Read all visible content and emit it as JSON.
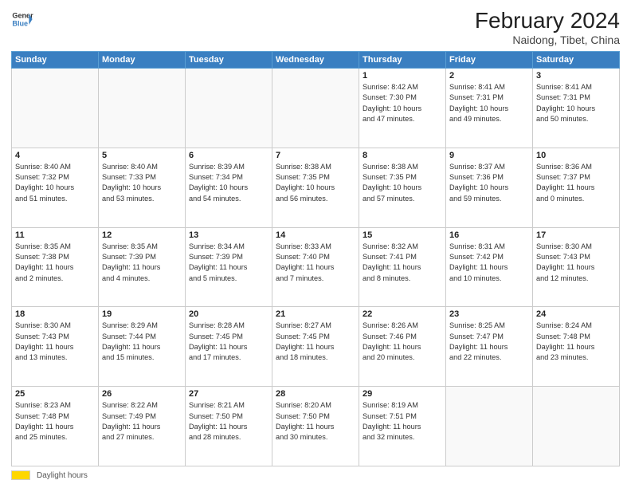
{
  "header": {
    "logo_line1": "General",
    "logo_line2": "Blue",
    "title": "February 2024",
    "subtitle": "Naidong, Tibet, China"
  },
  "days_of_week": [
    "Sunday",
    "Monday",
    "Tuesday",
    "Wednesday",
    "Thursday",
    "Friday",
    "Saturday"
  ],
  "footer": {
    "swatch_label": "Daylight hours"
  },
  "weeks": [
    [
      {
        "day": null,
        "info": null
      },
      {
        "day": null,
        "info": null
      },
      {
        "day": null,
        "info": null
      },
      {
        "day": null,
        "info": null
      },
      {
        "day": "1",
        "info": "Sunrise: 8:42 AM\nSunset: 7:30 PM\nDaylight: 10 hours\nand 47 minutes."
      },
      {
        "day": "2",
        "info": "Sunrise: 8:41 AM\nSunset: 7:31 PM\nDaylight: 10 hours\nand 49 minutes."
      },
      {
        "day": "3",
        "info": "Sunrise: 8:41 AM\nSunset: 7:31 PM\nDaylight: 10 hours\nand 50 minutes."
      }
    ],
    [
      {
        "day": "4",
        "info": "Sunrise: 8:40 AM\nSunset: 7:32 PM\nDaylight: 10 hours\nand 51 minutes."
      },
      {
        "day": "5",
        "info": "Sunrise: 8:40 AM\nSunset: 7:33 PM\nDaylight: 10 hours\nand 53 minutes."
      },
      {
        "day": "6",
        "info": "Sunrise: 8:39 AM\nSunset: 7:34 PM\nDaylight: 10 hours\nand 54 minutes."
      },
      {
        "day": "7",
        "info": "Sunrise: 8:38 AM\nSunset: 7:35 PM\nDaylight: 10 hours\nand 56 minutes."
      },
      {
        "day": "8",
        "info": "Sunrise: 8:38 AM\nSunset: 7:35 PM\nDaylight: 10 hours\nand 57 minutes."
      },
      {
        "day": "9",
        "info": "Sunrise: 8:37 AM\nSunset: 7:36 PM\nDaylight: 10 hours\nand 59 minutes."
      },
      {
        "day": "10",
        "info": "Sunrise: 8:36 AM\nSunset: 7:37 PM\nDaylight: 11 hours\nand 0 minutes."
      }
    ],
    [
      {
        "day": "11",
        "info": "Sunrise: 8:35 AM\nSunset: 7:38 PM\nDaylight: 11 hours\nand 2 minutes."
      },
      {
        "day": "12",
        "info": "Sunrise: 8:35 AM\nSunset: 7:39 PM\nDaylight: 11 hours\nand 4 minutes."
      },
      {
        "day": "13",
        "info": "Sunrise: 8:34 AM\nSunset: 7:39 PM\nDaylight: 11 hours\nand 5 minutes."
      },
      {
        "day": "14",
        "info": "Sunrise: 8:33 AM\nSunset: 7:40 PM\nDaylight: 11 hours\nand 7 minutes."
      },
      {
        "day": "15",
        "info": "Sunrise: 8:32 AM\nSunset: 7:41 PM\nDaylight: 11 hours\nand 8 minutes."
      },
      {
        "day": "16",
        "info": "Sunrise: 8:31 AM\nSunset: 7:42 PM\nDaylight: 11 hours\nand 10 minutes."
      },
      {
        "day": "17",
        "info": "Sunrise: 8:30 AM\nSunset: 7:43 PM\nDaylight: 11 hours\nand 12 minutes."
      }
    ],
    [
      {
        "day": "18",
        "info": "Sunrise: 8:30 AM\nSunset: 7:43 PM\nDaylight: 11 hours\nand 13 minutes."
      },
      {
        "day": "19",
        "info": "Sunrise: 8:29 AM\nSunset: 7:44 PM\nDaylight: 11 hours\nand 15 minutes."
      },
      {
        "day": "20",
        "info": "Sunrise: 8:28 AM\nSunset: 7:45 PM\nDaylight: 11 hours\nand 17 minutes."
      },
      {
        "day": "21",
        "info": "Sunrise: 8:27 AM\nSunset: 7:45 PM\nDaylight: 11 hours\nand 18 minutes."
      },
      {
        "day": "22",
        "info": "Sunrise: 8:26 AM\nSunset: 7:46 PM\nDaylight: 11 hours\nand 20 minutes."
      },
      {
        "day": "23",
        "info": "Sunrise: 8:25 AM\nSunset: 7:47 PM\nDaylight: 11 hours\nand 22 minutes."
      },
      {
        "day": "24",
        "info": "Sunrise: 8:24 AM\nSunset: 7:48 PM\nDaylight: 11 hours\nand 23 minutes."
      }
    ],
    [
      {
        "day": "25",
        "info": "Sunrise: 8:23 AM\nSunset: 7:48 PM\nDaylight: 11 hours\nand 25 minutes."
      },
      {
        "day": "26",
        "info": "Sunrise: 8:22 AM\nSunset: 7:49 PM\nDaylight: 11 hours\nand 27 minutes."
      },
      {
        "day": "27",
        "info": "Sunrise: 8:21 AM\nSunset: 7:50 PM\nDaylight: 11 hours\nand 28 minutes."
      },
      {
        "day": "28",
        "info": "Sunrise: 8:20 AM\nSunset: 7:50 PM\nDaylight: 11 hours\nand 30 minutes."
      },
      {
        "day": "29",
        "info": "Sunrise: 8:19 AM\nSunset: 7:51 PM\nDaylight: 11 hours\nand 32 minutes."
      },
      {
        "day": null,
        "info": null
      },
      {
        "day": null,
        "info": null
      }
    ]
  ]
}
